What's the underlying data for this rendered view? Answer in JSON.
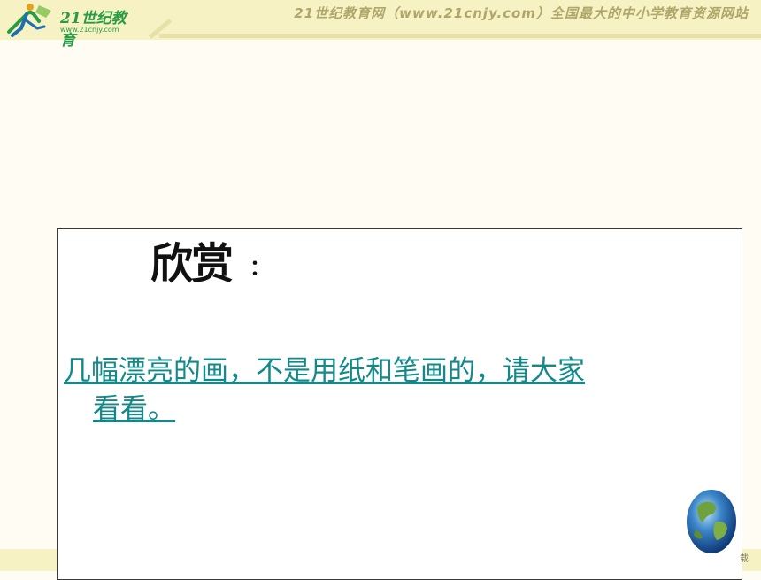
{
  "header": {
    "logo_text": "21世纪教育",
    "logo_url": "www.21cnjy.com",
    "banner": "21世纪教育网（www.21cnjy.com）全国最大的中小学教育资源网站"
  },
  "slide": {
    "title": "欣赏",
    "title_colon": "：",
    "link_line1": "几幅漂亮的画，不是用纸和笔画的，请大家",
    "link_line2": "看看。 "
  },
  "footer": {
    "corner_text": "载"
  },
  "icons": {
    "logo": "runner-logo-icon",
    "globe": "globe-icon"
  },
  "colors": {
    "link": "#138A8A",
    "header_band": "#F6F2C4",
    "logo_green": "#2A9A46"
  }
}
